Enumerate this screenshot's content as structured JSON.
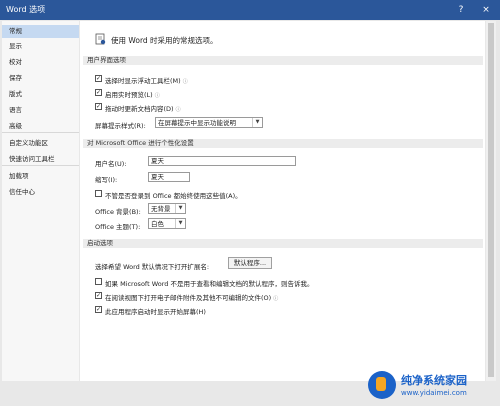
{
  "window": {
    "title": "Word 选项",
    "help": "?",
    "close": "×"
  },
  "sidebar": {
    "items": [
      {
        "label": "常规"
      },
      {
        "label": "显示"
      },
      {
        "label": "校对"
      },
      {
        "label": "保存"
      },
      {
        "label": "版式"
      },
      {
        "label": "语言"
      },
      {
        "label": "高级"
      },
      {
        "label": "自定义功能区"
      },
      {
        "label": "快速访问工具栏"
      },
      {
        "label": "加载项"
      },
      {
        "label": "信任中心"
      }
    ]
  },
  "main": {
    "header": "使用 Word 时采用的常规选项。",
    "ui_section": {
      "title": "用户界面选项",
      "options": [
        {
          "label": "选择时显示浮动工具栏(M)",
          "checked": true
        },
        {
          "label": "启用实时预览(L)",
          "checked": true
        },
        {
          "label": "拖动时更新文档内容(D)",
          "checked": true
        }
      ],
      "tooltip_label": "屏幕提示样式(R):",
      "tooltip_value": "在屏幕提示中显示功能说明"
    },
    "personal_section": {
      "title": "对 Microsoft Office 进行个性化设置",
      "username_label": "用户名(U):",
      "username_value": "夏天",
      "initials_label": "缩写(I):",
      "initials_value": "夏天",
      "signin_label": "不管是否登录到 Office 都始终使用这些值(A)。",
      "signin_checked": false,
      "background_label": "Office 背景(B):",
      "background_value": "无背景",
      "theme_label": "Office 主题(T):",
      "theme_value": "白色"
    },
    "startup_section": {
      "title": "启动选项",
      "ext_label": "选择希望 Word 默认情况下打开扩展名:",
      "ext_button": "默认程序...",
      "options": [
        {
          "label": "如果 Microsoft Word 不是用于查看和编辑文档的默认程序，则告诉我。",
          "checked": false
        },
        {
          "label": "在阅读视图下打开电子邮件附件及其他不可编辑的文件(O)",
          "checked": true
        },
        {
          "label": "此应用程序启动时显示开始屏幕(H)",
          "checked": true
        }
      ]
    }
  },
  "watermark": {
    "title": "纯净系统家园",
    "url": "www.yidaimei.com"
  }
}
